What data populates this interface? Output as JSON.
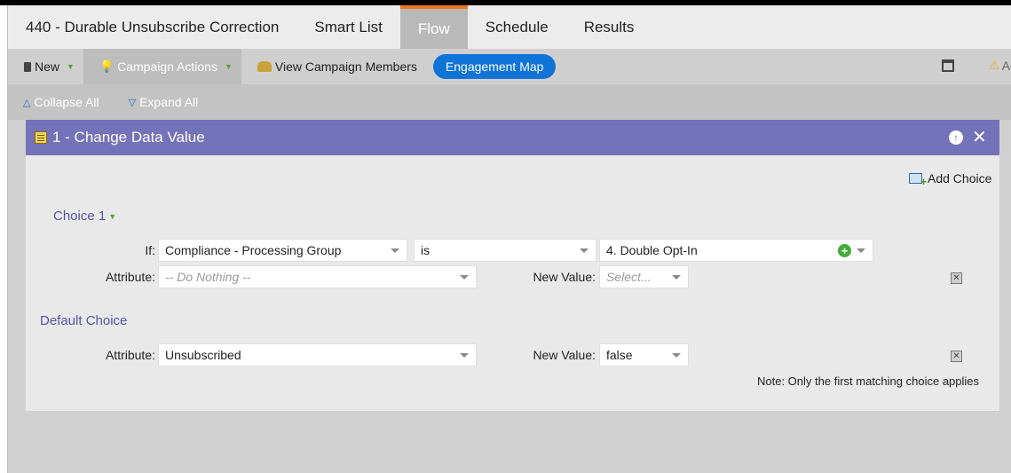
{
  "header": {
    "campaign_title": "440 - Durable Unsubscribe Correction",
    "tabs": [
      {
        "label": "Smart List"
      },
      {
        "label": "Flow"
      },
      {
        "label": "Schedule"
      },
      {
        "label": "Results"
      }
    ],
    "active_tab": "Flow"
  },
  "toolbar": {
    "new_label": "New",
    "campaign_actions_label": "Campaign Actions",
    "view_members_label": "View Campaign Members",
    "engagement_map_label": "Engagement Map",
    "alert_label": "Ac"
  },
  "subbar": {
    "collapse_label": "Collapse All",
    "expand_label": "Expand All"
  },
  "step": {
    "title": "1 - Change Data Value",
    "add_choice_label": "Add Choice",
    "choice1": {
      "label": "Choice 1",
      "if_label": "If:",
      "field": "Compliance - Processing Group",
      "operator": "is",
      "value": "4. Double Opt-In",
      "attribute_label": "Attribute:",
      "attribute_placeholder": "-- Do Nothing --",
      "new_value_label": "New Value:",
      "new_value_placeholder": "Select..."
    },
    "default_choice": {
      "label": "Default Choice",
      "attribute_label": "Attribute:",
      "attribute": "Unsubscribed",
      "new_value_label": "New Value:",
      "new_value": "false"
    },
    "note": "Note: Only the first matching choice applies"
  },
  "colors": {
    "active_tab_accent": "#f2761d",
    "panel_header": "#7472b8",
    "engagement_button": "#1073d8",
    "choice_label": "#5355a8"
  }
}
